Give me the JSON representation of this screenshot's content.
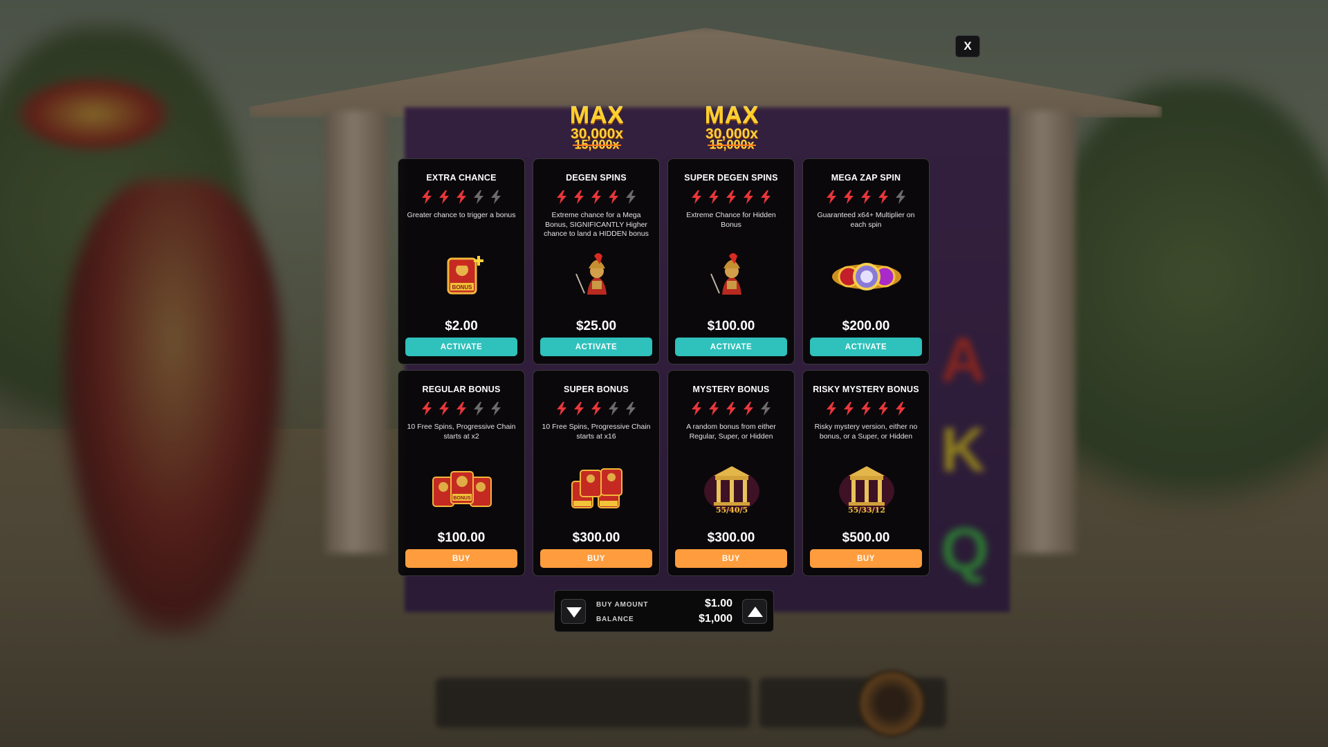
{
  "close": {
    "label": "X"
  },
  "max_badges": [
    {
      "line1": "MAX",
      "line2": "30,000x",
      "line3": "15,000x"
    },
    {
      "line1": "MAX",
      "line2": "30,000x",
      "line3": "15,000x"
    }
  ],
  "colors": {
    "activate": "#2fc1bb",
    "buy": "#ff9d3e",
    "bolt_active": "#e8363a",
    "bolt_inactive": "#6b6b6b",
    "card_bg": "#0a080a"
  },
  "cards": [
    {
      "title": "EXTRA CHANCE",
      "rating": 3,
      "desc": "Greater chance to trigger a bonus",
      "price": "$2.00",
      "button": "ACTIVATE",
      "icon": "bonus-plus-icon"
    },
    {
      "title": "DEGEN SPINS",
      "rating": 4,
      "desc": "Extreme chance for a Mega Bonus, SIGNIFICANTLY Higher chance to land a HIDDEN bonus",
      "price": "$25.00",
      "button": "ACTIVATE",
      "icon": "spartan-warrior-icon"
    },
    {
      "title": "SUPER DEGEN SPINS",
      "rating": 5,
      "desc": "Extreme Chance for Hidden Bonus",
      "price": "$100.00",
      "button": "ACTIVATE",
      "icon": "spartan-warrior-icon"
    },
    {
      "title": "MEGA ZAP SPIN",
      "rating": 4,
      "desc": "Guaranteed x64+ Multiplier on each spin",
      "price": "$200.00",
      "button": "ACTIVATE",
      "icon": "zap-orb-icon"
    },
    {
      "title": "REGULAR BONUS",
      "rating": 3,
      "desc": "10 Free Spins, Progressive Chain starts at x2",
      "price": "$100.00",
      "button": "BUY",
      "icon": "three-bonus-icon"
    },
    {
      "title": "SUPER BONUS",
      "rating": 3,
      "desc": "10 Free Spins, Progressive Chain starts at x16",
      "price": "$300.00",
      "button": "BUY",
      "icon": "four-bonus-icon"
    },
    {
      "title": "MYSTERY BONUS",
      "rating": 4,
      "desc": "A random bonus from either Regular, Super, or Hidden",
      "price": "$300.00",
      "button": "BUY",
      "icon": "temple-odds-icon",
      "odds": "55/40/5"
    },
    {
      "title": "RISKY MYSTERY BONUS",
      "rating": 5,
      "desc": "Risky mystery version, either no bonus, or a Super, or Hidden",
      "price": "$500.00",
      "button": "BUY",
      "icon": "temple-odds-icon",
      "odds": "55/33/12"
    }
  ],
  "amount": {
    "buy_label": "BUY AMOUNT",
    "buy_value": "$1.00",
    "balance_label": "BALANCE",
    "balance_value": "$1,000"
  }
}
